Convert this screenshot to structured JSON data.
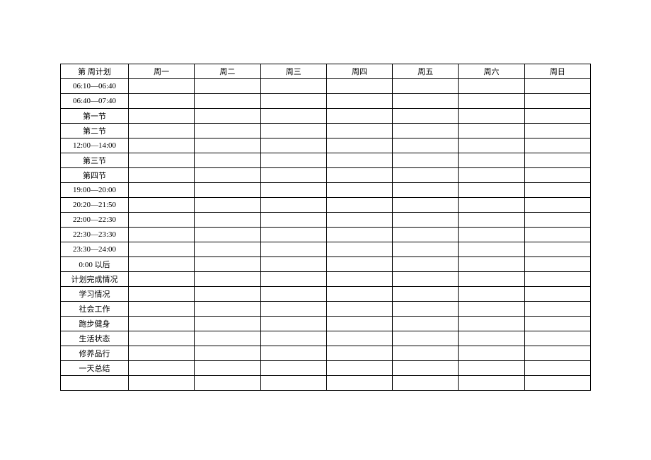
{
  "header": {
    "title": "第    周计划",
    "days": [
      "周一",
      "周二",
      "周三",
      "周四",
      "周五",
      "周六",
      "周日"
    ]
  },
  "rows": [
    "06:10—06:40",
    "06:40—07:40",
    "第一节",
    "第二节",
    "12:00—14:00",
    "第三节",
    "第四节",
    "19:00—20:00",
    "20:20—21:50",
    "22:00—22:30",
    "22:30—23:30",
    "23:30—24:00",
    "0:00 以后",
    "计划完成情况",
    "学习情况",
    "社会工作",
    "跑步健身",
    "生活状态",
    "修养品行",
    "一天总结"
  ]
}
